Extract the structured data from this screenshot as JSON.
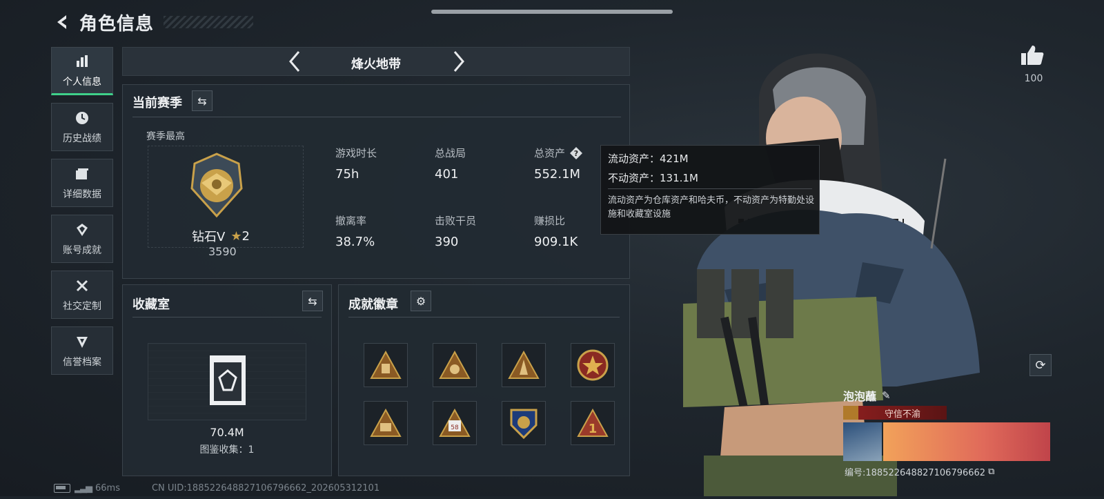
{
  "header": {
    "title": "角色信息"
  },
  "sidebar": {
    "items": [
      {
        "label": "个人信息",
        "icon": "bar-chart-icon",
        "active": true
      },
      {
        "label": "历史战绩",
        "icon": "history-icon"
      },
      {
        "label": "详细数据",
        "icon": "folder-icon"
      },
      {
        "label": "账号成就",
        "icon": "achievement-icon"
      },
      {
        "label": "社交定制",
        "icon": "tools-icon"
      },
      {
        "label": "信誉档案",
        "icon": "shield-icon"
      }
    ]
  },
  "mode": {
    "name": "烽火地带"
  },
  "season": {
    "title": "当前赛季",
    "best_label": "赛季最高",
    "rank_name": "钻石V",
    "rank_stars": "2",
    "rank_score": "3590",
    "stats": [
      {
        "label": "游戏时长",
        "value": "75h"
      },
      {
        "label": "总战局",
        "value": "401"
      },
      {
        "label": "总资产",
        "value": "552.1M"
      },
      {
        "label": "撤离率",
        "value": "38.7%"
      },
      {
        "label": "击败干员",
        "value": "390"
      },
      {
        "label": "赚损比",
        "value": "909.1K"
      }
    ]
  },
  "tooltip": {
    "liquid": "流动资产：421M",
    "fixed": "不动资产：131.1M",
    "note": "流动资产为仓库资产和哈夫币，不动资产为特勤处设施和收藏室设施"
  },
  "collection": {
    "title": "收藏室",
    "value": "70.4M",
    "count_label": "图鉴收集：1"
  },
  "achievements": {
    "title": "成就徽章"
  },
  "likes": {
    "count": "100"
  },
  "profile": {
    "name": "泡泡蘸",
    "title_badge": "守信不渝",
    "id_text": "编号:1885226488271067966​62"
  },
  "footer": {
    "ping": "66ms",
    "uid": "CN UID:18852264882710679666​2_202605312101"
  },
  "colors": {
    "accent_green": "#3fd08a",
    "gold": "#c9a14a",
    "title_red": "#8d1f1f"
  }
}
